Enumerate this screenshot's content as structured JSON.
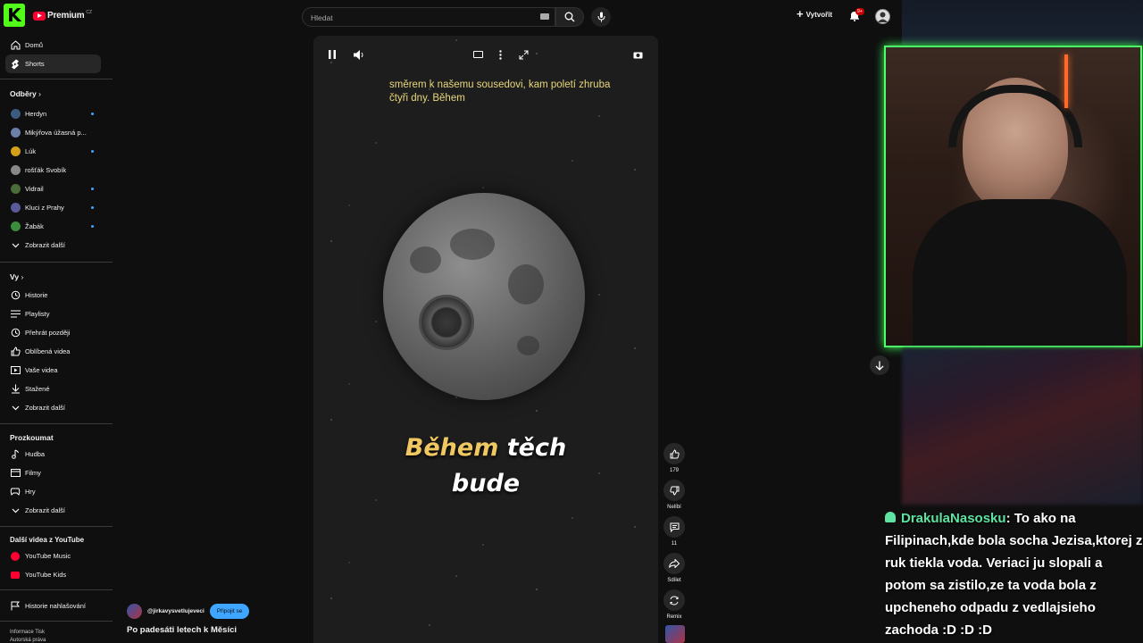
{
  "header": {
    "logo_letter": "K",
    "brand": "Premium",
    "brand_sup": "CZ",
    "search_placeholder": "Hledat",
    "create_label": "Vytvořit",
    "notif_badge": "9+"
  },
  "sidebar": {
    "top": [
      {
        "label": "Domů",
        "icon": "home-icon"
      },
      {
        "label": "Shorts",
        "icon": "shorts-icon"
      }
    ],
    "subs_heading": "Odběry",
    "subs": [
      {
        "label": "Herdyn",
        "color": "#3d5a80"
      },
      {
        "label": "Mikýřova úžasná p...",
        "color": "#6b7fa8"
      },
      {
        "label": "Lúk",
        "color": "#d4a017"
      },
      {
        "label": "rošťák Svobík",
        "color": "#888888"
      },
      {
        "label": "Vidrail",
        "color": "#4a6b3a"
      },
      {
        "label": "Kluci z Prahy",
        "color": "#5a5a9a"
      },
      {
        "label": "Žabák",
        "color": "#3c8c3c"
      }
    ],
    "show_more": "Zobrazit další",
    "you_heading": "Vy",
    "you": [
      {
        "label": "Historie",
        "icon": "history-icon"
      },
      {
        "label": "Playlisty",
        "icon": "playlist-icon"
      },
      {
        "label": "Přehrát později",
        "icon": "clock-icon"
      },
      {
        "label": "Oblíbená videa",
        "icon": "like-icon"
      },
      {
        "label": "Vaše videa",
        "icon": "video-icon"
      },
      {
        "label": "Stažené",
        "icon": "download-icon"
      }
    ],
    "explore_heading": "Prozkoumat",
    "explore": [
      {
        "label": "Hudba",
        "icon": "music-icon"
      },
      {
        "label": "Filmy",
        "icon": "film-icon"
      },
      {
        "label": "Hry",
        "icon": "gamepad-icon"
      }
    ],
    "more_heading": "Další videa z YouTube",
    "more": [
      {
        "label": "YouTube Music"
      },
      {
        "label": "YouTube Kids"
      }
    ],
    "report_history": "Historie nahlašování",
    "footer_1": "Informace  Tisk",
    "footer_2": "Autorská práva"
  },
  "video": {
    "subtitle_small": "směrem k našemu sousedovi, kam poletí zhruba čtyři dny. Během",
    "caption_hl": "Během",
    "caption_rest": "těch",
    "caption_line2": "bude",
    "channel": "@jirkavysvetlujeveci",
    "subscribe": "Připojit se",
    "title": "Po padesáti letech k Měsíci"
  },
  "actions": {
    "likes": "179",
    "dislike": "Nelíbí",
    "comments": "11",
    "share": "Sdílet",
    "remix": "Remix"
  },
  "chat": {
    "user": "DrakulaNasosku",
    "message": ": To ako na Filipinach,kde bola socha Jezisa,ktorej z ruk tiekla voda. Veriaci ju slopali a potom sa zistilo,ze ta voda bola z upcheneho odpadu z vedlajsieho zachoda :D :D :D"
  },
  "colors": {
    "accent": "#ff0033",
    "cam_border": "#4cff6a",
    "chat_user": "#5fe3a1",
    "caption_highlight": "#f0c862",
    "logo_bg": "#53fc18"
  }
}
